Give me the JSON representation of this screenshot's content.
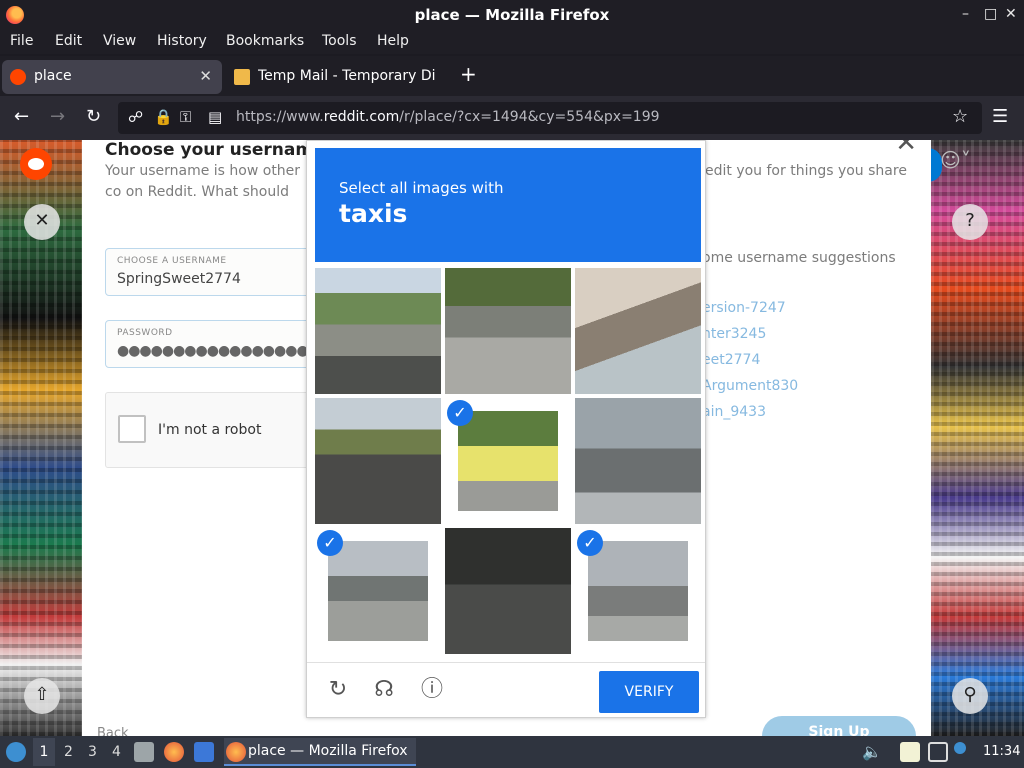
{
  "window": {
    "title": "place — Mozilla Firefox",
    "minimize": "–",
    "maximize": "□",
    "close": "✕"
  },
  "menu": {
    "items": [
      "File",
      "Edit",
      "View",
      "History",
      "Bookmarks",
      "Tools",
      "Help"
    ]
  },
  "tabs": [
    {
      "label": "place",
      "close": "✕"
    },
    {
      "label": "Temp Mail - Temporary Di"
    }
  ],
  "nav": {
    "url_prefix": "https://www.",
    "url_domain": "reddit.com",
    "url_suffix": "/r/place/?cx=1494&cy=554&px=199"
  },
  "signup": {
    "heading": "Choose your username",
    "desc_left": "Your username is how other co on Reddit. What should we call",
    "desc_right": "edit you for things you share",
    "username_label": "CHOOSE A USERNAME",
    "username_value": "SpringSweet2774",
    "password_label": "PASSWORD",
    "password_value": "●●●●●●●●●●●●●●●●●",
    "recaptcha_label": "I'm not a robot",
    "suggestions_heading": "ome username suggestions",
    "suggestions": [
      "ersion-7247",
      "nter3245",
      "eet2774",
      "Argument830",
      "ain_9433"
    ],
    "back": "Back",
    "signup_button": "Sign Up"
  },
  "captcha": {
    "instruction": "Select all images with",
    "target": "taxis",
    "verify": "VERIFY",
    "tiles": [
      {
        "selected": false
      },
      {
        "selected": false
      },
      {
        "selected": false
      },
      {
        "selected": false
      },
      {
        "selected": true
      },
      {
        "selected": false
      },
      {
        "selected": true
      },
      {
        "selected": false
      },
      {
        "selected": true
      }
    ]
  },
  "taskbar": {
    "workspaces": [
      "1",
      "2",
      "3",
      "4"
    ],
    "active_window": "place — Mozilla Firefox",
    "clock": "11:34"
  }
}
